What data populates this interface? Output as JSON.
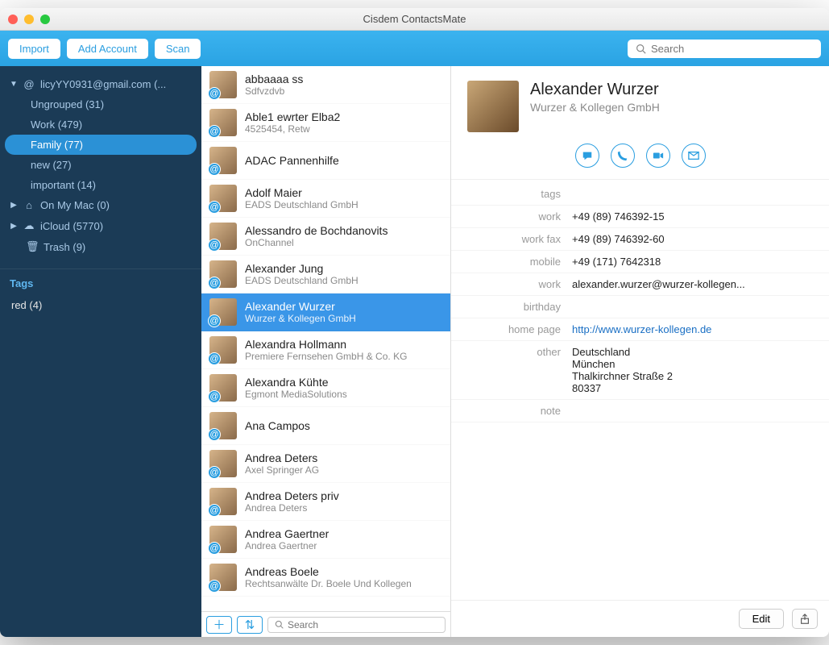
{
  "window": {
    "title": "Cisdem ContactsMate"
  },
  "toolbar": {
    "import": "Import",
    "add_account": "Add Account",
    "scan": "Scan",
    "search_placeholder": "Search"
  },
  "sidebar": {
    "accounts": [
      {
        "kind": "account",
        "icon": "at",
        "label": "licyYY0931@gmail.com (...",
        "expanded": true,
        "children": [
          {
            "label": "Ungrouped (31)",
            "selected": false
          },
          {
            "label": "Work (479)",
            "selected": false
          },
          {
            "label": "Family (77)",
            "selected": true
          },
          {
            "label": "new (27)",
            "selected": false
          },
          {
            "label": "important (14)",
            "selected": false
          }
        ]
      },
      {
        "kind": "account",
        "icon": "home",
        "label": "On My Mac (0)",
        "expanded": false
      },
      {
        "kind": "account",
        "icon": "cloud",
        "label": "iCloud (5770)",
        "expanded": false
      },
      {
        "kind": "trash",
        "icon": "trash",
        "label": "Trash (9)"
      }
    ],
    "tags_header": "Tags",
    "tags": [
      {
        "label": "red (4)"
      }
    ]
  },
  "contacts": [
    {
      "name": "abbaaaa ss",
      "sub": "Sdfvzdvb"
    },
    {
      "name": "Able1 ewrter Elba2",
      "sub": "4525454, Retw"
    },
    {
      "name": "ADAC Pannenhilfe",
      "sub": ""
    },
    {
      "name": "Adolf Maier",
      "sub": "EADS Deutschland GmbH"
    },
    {
      "name": "Alessandro de Bochdanovits",
      "sub": "OnChannel"
    },
    {
      "name": "Alexander Jung",
      "sub": "EADS Deutschland GmbH"
    },
    {
      "name": "Alexander Wurzer",
      "sub": "Wurzer & Kollegen GmbH",
      "selected": true
    },
    {
      "name": "Alexandra Hollmann",
      "sub": "Premiere Fernsehen GmbH & Co. KG"
    },
    {
      "name": "Alexandra Kühte",
      "sub": "Egmont MediaSolutions"
    },
    {
      "name": "Ana Campos",
      "sub": ""
    },
    {
      "name": "Andrea Deters",
      "sub": "Axel Springer AG"
    },
    {
      "name": "Andrea Deters priv",
      "sub": "Andrea Deters"
    },
    {
      "name": "Andrea Gaertner",
      "sub": "Andrea Gaertner"
    },
    {
      "name": "Andreas Boele",
      "sub": "Rechtsanwälte Dr. Boele Und Kollegen"
    }
  ],
  "list_toolbar": {
    "search_placeholder": "Search"
  },
  "detail": {
    "name": "Alexander Wurzer",
    "company": "Wurzer & Kollegen GmbH",
    "fields": [
      {
        "label": "tags",
        "value": ""
      },
      {
        "label": "work",
        "value": "+49 (89) 746392-15"
      },
      {
        "label": "work fax",
        "value": "+49 (89) 746392-60"
      },
      {
        "label": "mobile",
        "value": "+49 (171) 7642318"
      },
      {
        "label": "work",
        "value": "alexander.wurzer@wurzer-kollegen..."
      },
      {
        "label": "birthday",
        "value": ""
      },
      {
        "label": "home page",
        "value": "http://www.wurzer-kollegen.de",
        "link": true
      },
      {
        "label": "other",
        "value": "Deutschland\nMünchen\nThalkirchner Straße 2\n80337"
      },
      {
        "label": "note",
        "value": ""
      }
    ],
    "edit": "Edit"
  }
}
